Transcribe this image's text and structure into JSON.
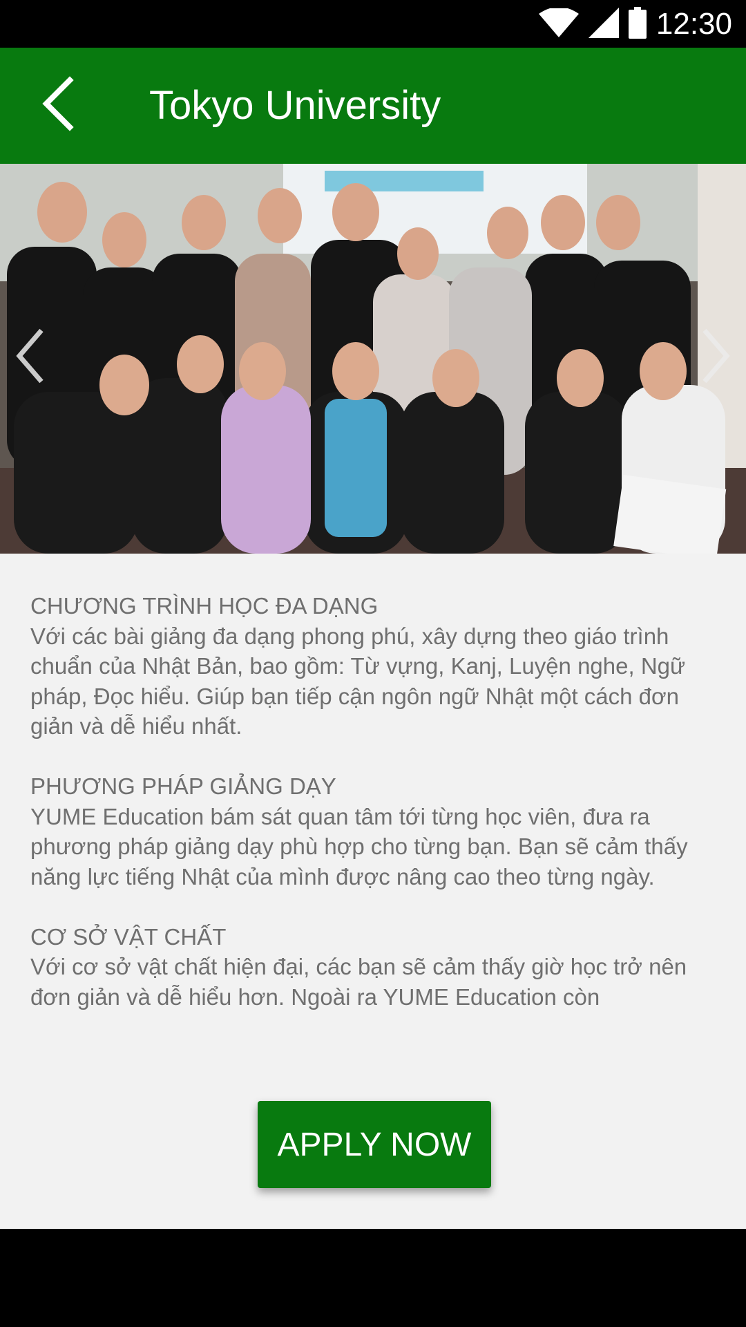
{
  "status_bar": {
    "time": "12:30",
    "icons": [
      "wifi-icon",
      "signal-icon",
      "battery-icon"
    ]
  },
  "app_bar": {
    "title": "Tokyo University",
    "back_icon": "arrow-back-icon"
  },
  "carousel": {
    "image_alt": "Group photo of students",
    "prev_icon": "chevron-left-icon",
    "next_icon": "chevron-right-icon"
  },
  "sections": [
    {
      "heading": "CHƯƠNG TRÌNH HỌC ĐA DẠNG",
      "body": "Với các bài giảng đa dạng phong phú, xây dựng theo giáo trình chuẩn của Nhật Bản, bao gồm: Từ vựng, Kanj, Luyện nghe, Ngữ pháp, Đọc hiểu. Giúp bạn tiếp cận ngôn ngữ Nhật một cách đơn giản và dễ hiểu nhất."
    },
    {
      "heading": "PHƯƠNG PHÁP GIẢNG DẠY",
      "body": "YUME Education bám sát quan tâm tới từng học viên, đưa ra phương pháp giảng dạy phù hợp cho từng bạn. Bạn sẽ cảm thấy năng lực tiếng Nhật của mình được nâng cao theo từng ngày."
    },
    {
      "heading": "CƠ SỞ VẬT CHẤT",
      "body": "Với cơ sở vật chất hiện đại, các bạn sẽ cảm thấy giờ học trở nên đơn giản và dễ hiểu hơn. Ngoài ra YUME Education còn"
    }
  ],
  "apply_button": {
    "label": "APPLY NOW"
  },
  "colors": {
    "primary": "#087a0f",
    "background": "#f2f2f2",
    "text": "#6f6f6f"
  }
}
